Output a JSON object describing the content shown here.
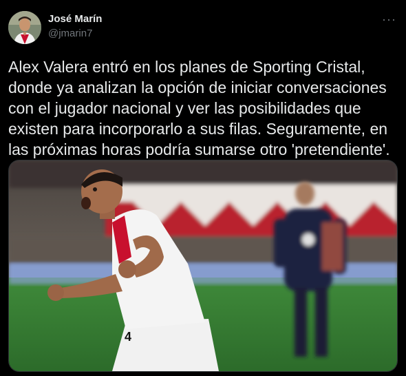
{
  "author": {
    "name": "José Marín",
    "handle": "@jmarin7",
    "avatar_icon": "profile-photo",
    "more_label": "···"
  },
  "tweet": {
    "text": "Alex Valera entró en los planes de Sporting Cristal, donde ya analizan la opción de iniciar conversaciones con el jugador nacional y ver las posibilidades que existen para incorporarlo a sus filas. Seguramente, en las próximas horas podría sumarse otro 'pretendiente'."
  },
  "media": {
    "description_icon": "photo-footballer-celebrating",
    "jersey_number": "4",
    "colors": {
      "background": "#000000",
      "text": "#e7e9ea",
      "secondary": "#71767b"
    }
  }
}
